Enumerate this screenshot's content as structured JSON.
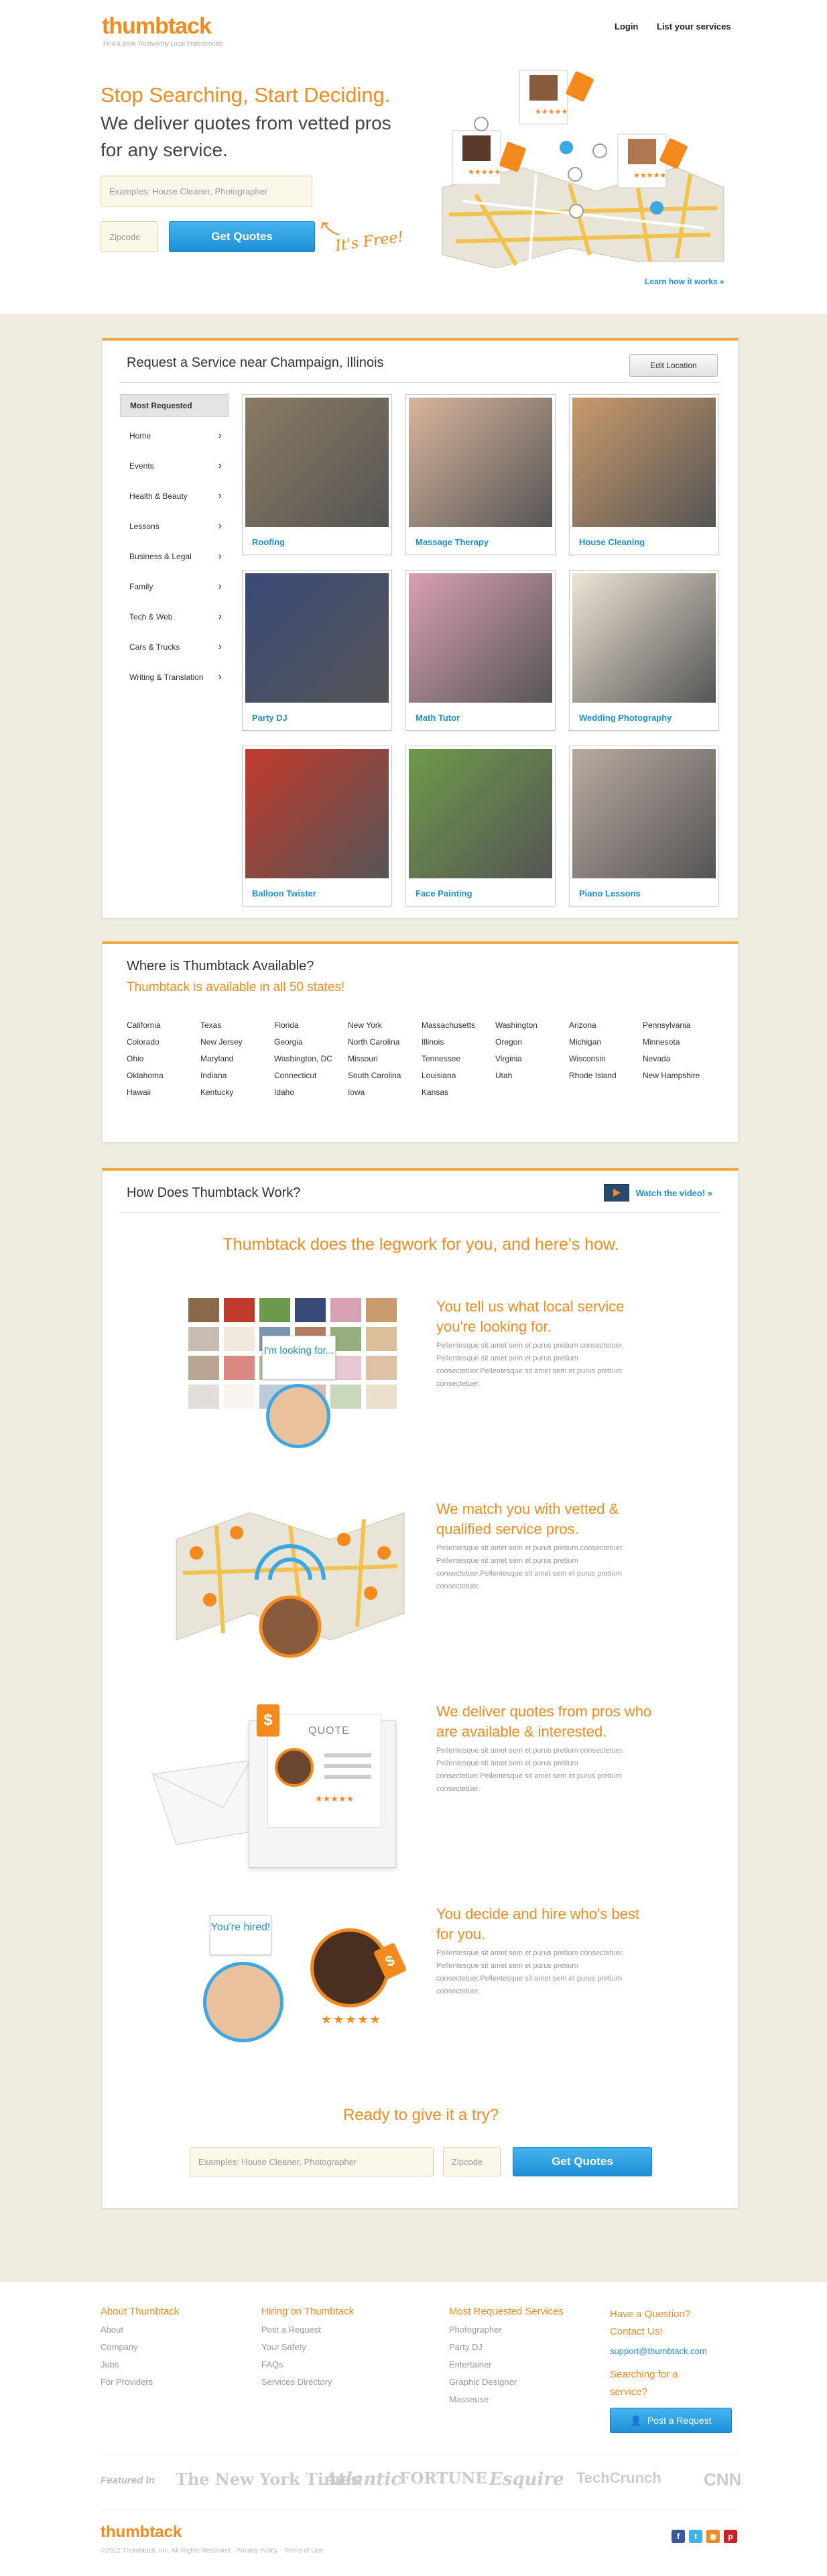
{
  "header": {
    "logo": "thumbtack",
    "tagline": "Find & Book Trustworthy Local Professionals",
    "login": "Login",
    "list_services": "List your services"
  },
  "hero": {
    "headline": "Stop Searching, Start Deciding.",
    "subhead": "We deliver quotes from vetted pros for any service.",
    "service_placeholder": "Examples: House Cleaner, Photographer",
    "zip_placeholder": "Zipcode",
    "cta": "Get Quotes",
    "free": "It's Free!",
    "learn_link": "Learn how it works »"
  },
  "request": {
    "title": "Request a Service near Champaign, Illinois",
    "edit_location": "Edit Location",
    "categories": [
      "Most Requested",
      "Home",
      "Events",
      "Health & Beauty",
      "Lessons",
      "Business & Legal",
      "Family",
      "Tech & Web",
      "Cars & Trucks",
      "Writing & Translation"
    ],
    "tiles": [
      {
        "label": "Roofing",
        "color": "#8a7b62"
      },
      {
        "label": "Massage Therapy",
        "color": "#d8b59c"
      },
      {
        "label": "House Cleaning",
        "color": "#c99a6b"
      },
      {
        "label": "Party DJ",
        "color": "#3a4a78"
      },
      {
        "label": "Math Tutor",
        "color": "#d9a0b4"
      },
      {
        "label": "Wedding Photography",
        "color": "#ede4d4"
      },
      {
        "label": "Balloon Twister",
        "color": "#c23a2c"
      },
      {
        "label": "Face Painting",
        "color": "#6d9a4a"
      },
      {
        "label": "Piano Lessons",
        "color": "#b9aaa0"
      }
    ]
  },
  "states": {
    "title": "Where is Thumbtack Available?",
    "subtitle": "Thumbtack is available in all 50 states!",
    "columns": [
      [
        "California",
        "Colorado",
        "Ohio",
        "Oklahoma",
        "Hawaii"
      ],
      [
        "Texas",
        "New Jersey",
        "Maryland",
        "Indiana",
        "Kentucky"
      ],
      [
        "Florida",
        "Georgia",
        "Washington, DC",
        "Connecticut",
        "Idaho"
      ],
      [
        "New York",
        "North Carolina",
        "Missouri",
        "South Carolina",
        "Iowa"
      ],
      [
        "Massachusetts",
        "Illinois",
        "Tennessee",
        "Louisiana",
        "Kansas"
      ],
      [
        "Washington",
        "Oregon",
        "Virginia",
        "Utah"
      ],
      [
        "Arizona",
        "Michigan",
        "Wisconsin",
        "Rhode Island"
      ],
      [
        "Pennsylvania",
        "Minnesota",
        "Nevada",
        "New Hampshire"
      ]
    ]
  },
  "how": {
    "title": "How Does Thumbtack Work?",
    "watch": "Watch the video! »",
    "tagline": "Thumbtack does the legwork for you, and here's how.",
    "bubble1": "I'm looking for...",
    "quote_word": "QUOTE",
    "bubble4": "You're hired!",
    "steps": [
      {
        "title": "You tell us what local service you're looking for.",
        "body": "Pellentesque sit amet sem et purus pretium consectetuer. Pellentesque sit amet sem et purus pretium consectetuer.Pellentesque sit amet sem et purus pretium consectetuer."
      },
      {
        "title": "We match you with vetted & qualified service pros.",
        "body": "Pellentesque sit amet sem et purus pretium consectetuer. Pellentesque sit amet sem et purus pretium consectetuer.Pellentesque sit amet sem et purus pretium consectetuer."
      },
      {
        "title": "We deliver quotes from pros who are available & interested.",
        "body": "Pellentesque sit amet sem et purus pretium consectetuer. Pellentesque sit amet sem et purus pretium consectetuer.Pellentesque sit amet sem et purus pretium consectetuer."
      },
      {
        "title": "You decide and hire who's best for you.",
        "body": "Pellentesque sit amet sem et purus pretium consectetuer. Pellentesque sit amet sem et purus pretium consectetuer.Pellentesque sit amet sem et purus pretium consectetuer."
      }
    ],
    "ready": "Ready to give it a try?",
    "service_placeholder": "Examples: House Cleaner, Photographer",
    "zip_placeholder": "Zipcode",
    "cta": "Get Quotes"
  },
  "footer": {
    "about": {
      "title": "About Thumbtack",
      "links": [
        "About",
        "Company",
        "Jobs",
        "For Providers"
      ]
    },
    "hiring": {
      "title": "Hiring on Thumbtack",
      "links": [
        "Post a Request",
        "Your Safety",
        "FAQs",
        "Services Directory"
      ]
    },
    "most": {
      "title": "Most Requested Services",
      "links": [
        "Photographer",
        "Party DJ",
        "Entertainer",
        "Graphic Designer",
        "Masseuse"
      ]
    },
    "question": "Have a Question? Contact Us!",
    "email": "support@thumbtack.com",
    "searching": "Searching for a service?",
    "post_button": "Post a Request",
    "featured": "Featured In",
    "press": [
      "The New York Times",
      "Atlantic",
      "FORTUNE",
      "Esquire",
      "TechCrunch",
      "CNN"
    ],
    "logo": "thumbtack",
    "copyright": "©2012 Thumbtack, Inc. All Rights Reserved",
    "privacy": "Privacy Policy",
    "terms": "Terms of Use"
  },
  "colors": {
    "accent": "#f48a1e",
    "link": "#1e8fd6",
    "background": "#efece0"
  }
}
